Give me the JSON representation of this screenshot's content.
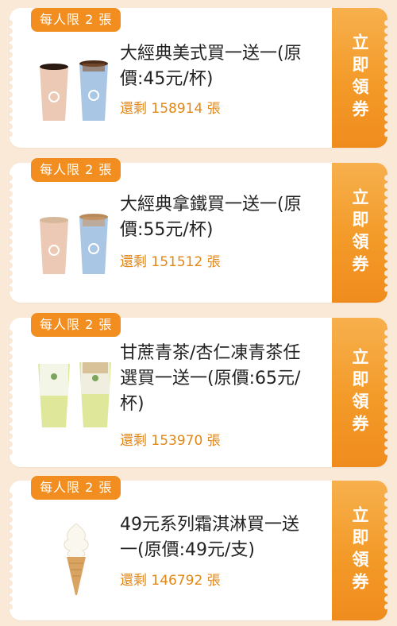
{
  "coupons": [
    {
      "badge": "每人限 2 張",
      "title": "大經典美式買一送一(原價:45元/杯)",
      "remaining": "還剩 158914 張",
      "claim_label": "立即領券",
      "product_icon": "americano-cups-image"
    },
    {
      "badge": "每人限 2 張",
      "title": "大經典拿鐵買一送一(原價:55元/杯)",
      "remaining": "還剩 151512 張",
      "claim_label": "立即領券",
      "product_icon": "latte-cups-image"
    },
    {
      "badge": "每人限 2 張",
      "title": "甘蔗青茶/杏仁凍青茶任選買一送一(原價:65元/杯)",
      "remaining": "還剩 153970 張",
      "claim_label": "立即領券",
      "product_icon": "green-tea-cups-image"
    },
    {
      "badge": "每人限 2 張",
      "title": "49元系列霜淇淋買一送一(原價:49元/支)",
      "remaining": "還剩 146792 張",
      "claim_label": "立即領券",
      "product_icon": "ice-cream-cone-image"
    }
  ],
  "colors": {
    "accent": "#f28d1f",
    "background": "#fbe9d8",
    "remaining_text": "#e38716"
  }
}
